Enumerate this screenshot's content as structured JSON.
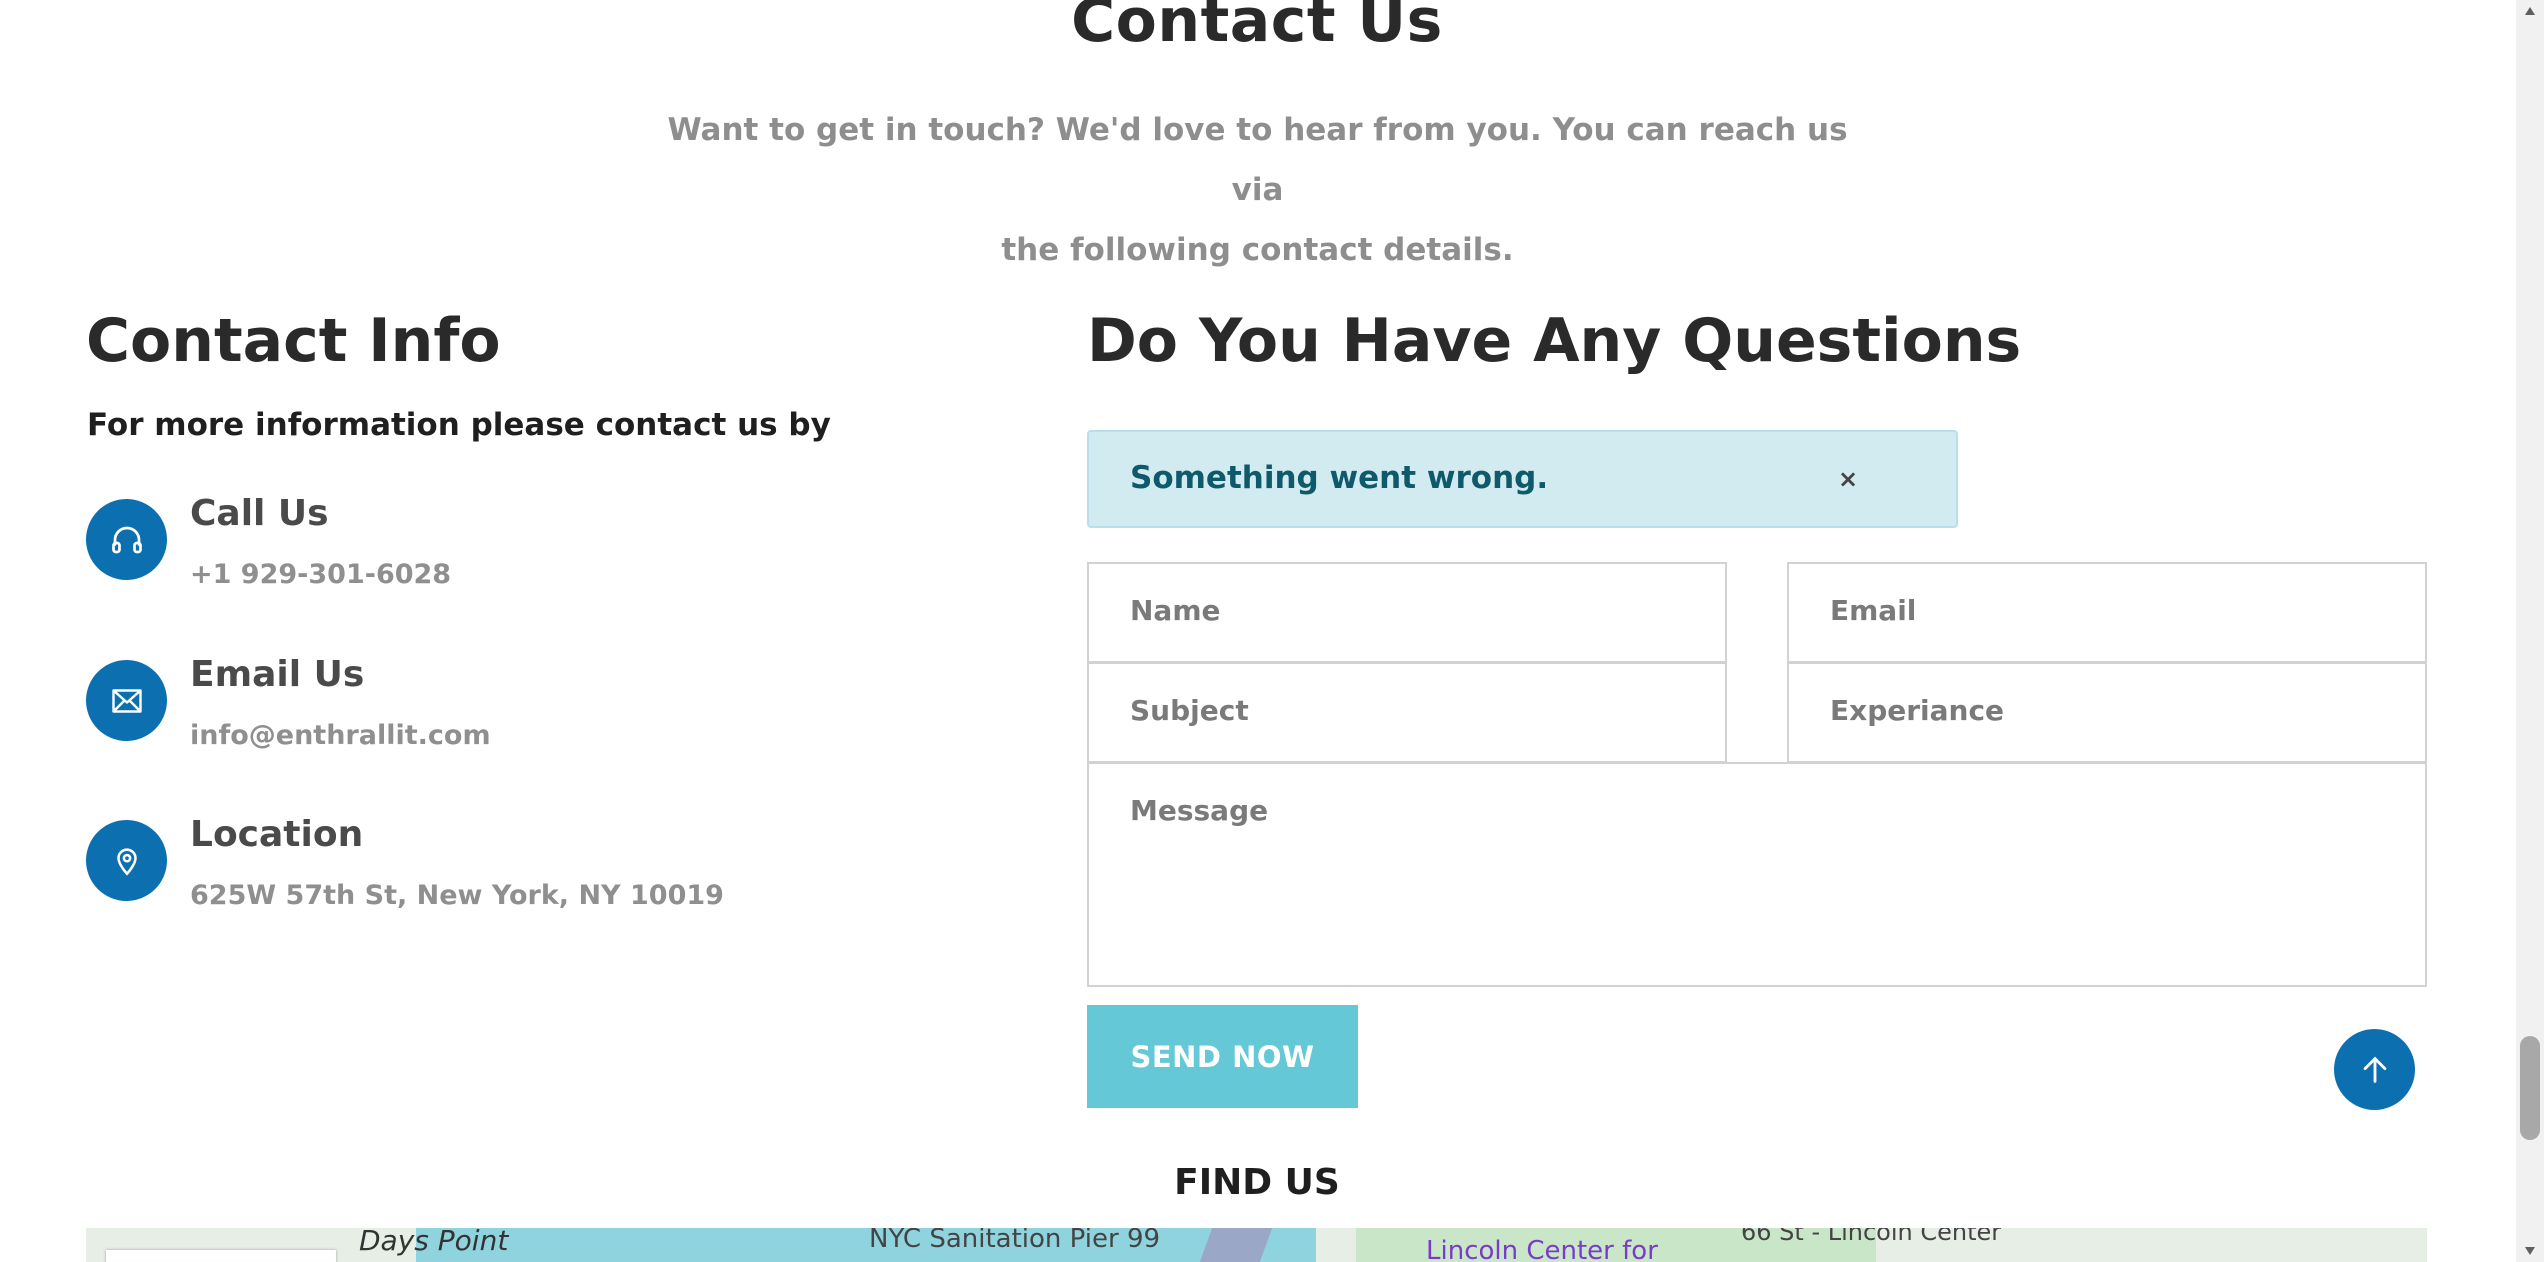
{
  "header": {
    "title": "Contact Us",
    "intro_line1": "Want to get in touch? We'd love to hear from you. You can reach us via",
    "intro_line2": "the following contact details."
  },
  "contact_info": {
    "title": "Contact Info",
    "subtitle": "For more information please contact us by",
    "items": [
      {
        "label": "Call Us",
        "value": "+1 929-301-6028",
        "icon": "headphones-icon"
      },
      {
        "label": "Email Us",
        "value": "info@enthrallit.com",
        "icon": "envelope-icon"
      },
      {
        "label": "Location",
        "value": "625W 57th St, New York, NY 10019",
        "icon": "map-pin-icon"
      }
    ]
  },
  "form": {
    "title": "Do You Have Any Questions",
    "alert": {
      "text": "Something went wrong.",
      "close": "×"
    },
    "fields": {
      "name": "Name",
      "email": "Email",
      "subject": "Subject",
      "experience": "Experiance",
      "message": "Message"
    },
    "submit_label": "SEND NOW"
  },
  "find_us": {
    "title": "FIND US",
    "map_labels": [
      "Days Point",
      "NYC Sanitation Pier 99",
      "Lincoln Center for",
      "66 St - Lincoln Center"
    ]
  },
  "colors": {
    "brand_blue": "#0b6fb0",
    "button_teal": "#64c8d7",
    "alert_bg": "#d2ebf0",
    "alert_text": "#0e5a6a"
  }
}
